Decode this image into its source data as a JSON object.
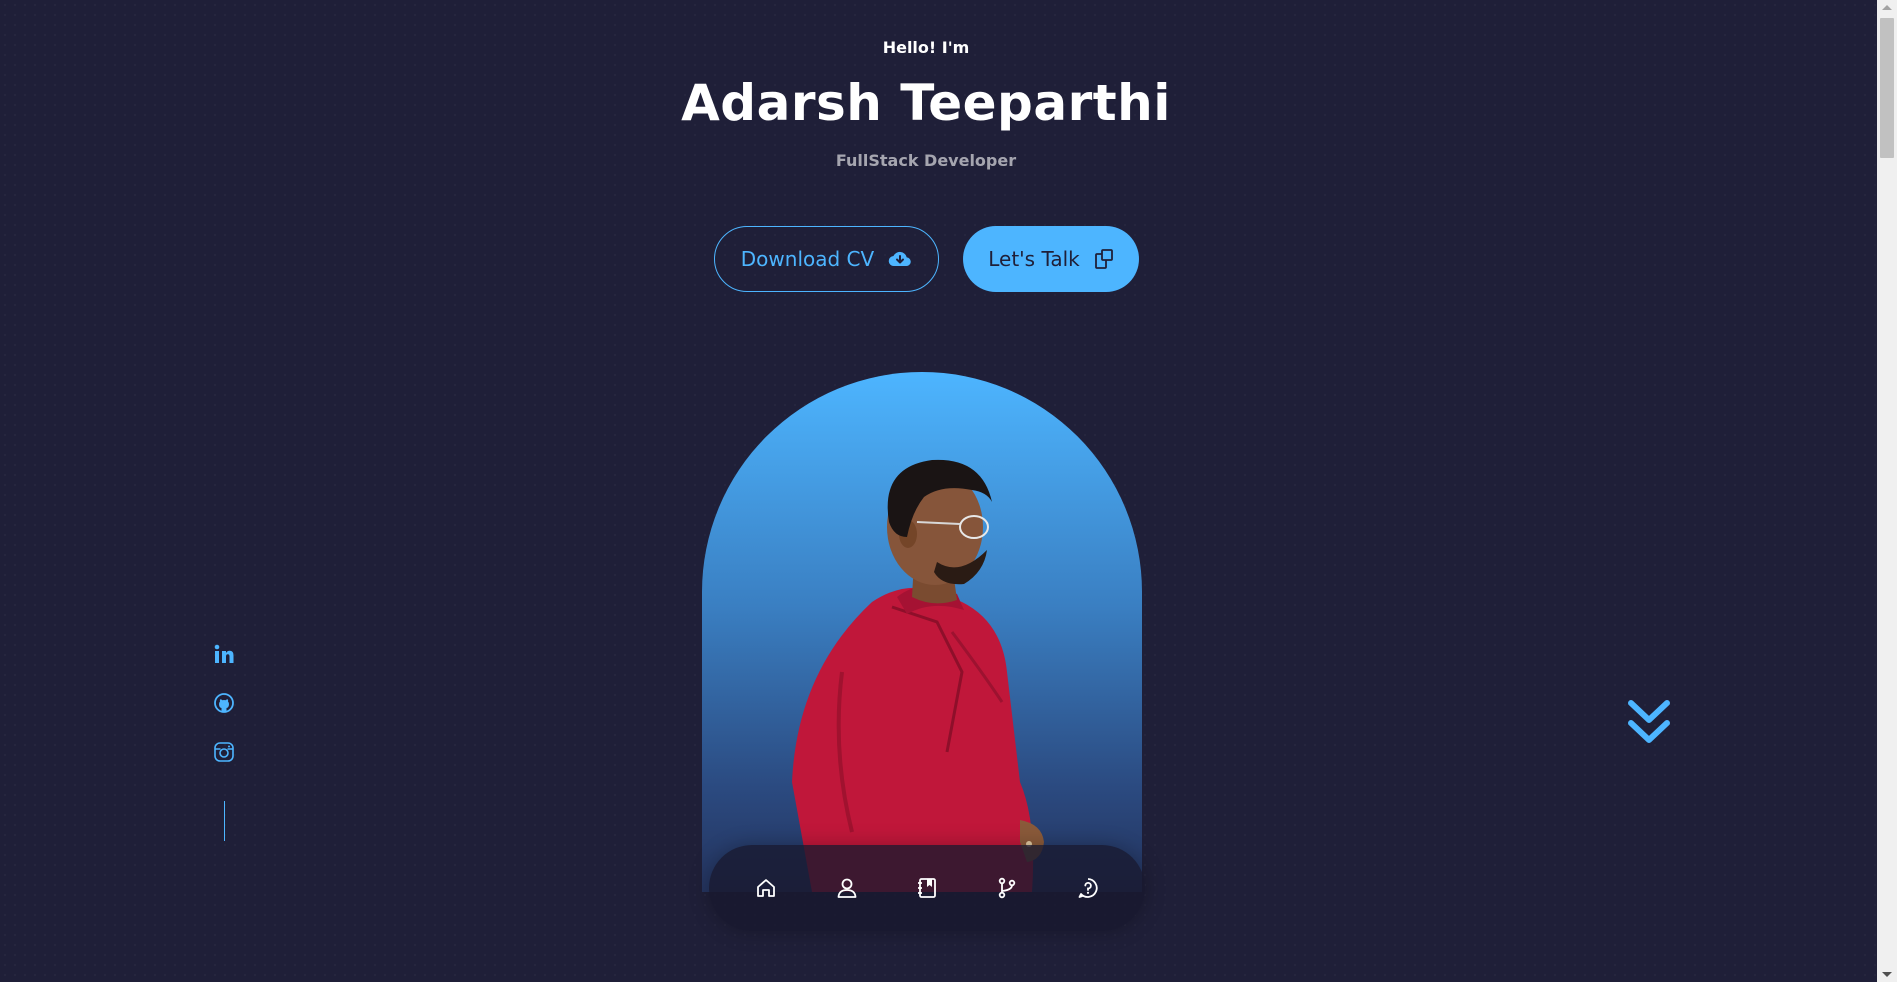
{
  "header": {
    "greeting": "Hello! I'm",
    "name": "Adarsh Teeparthi",
    "role": "FullStack Developer"
  },
  "cta": {
    "download_label": "Download CV",
    "talk_label": "Let's Talk"
  },
  "nav": {
    "items": [
      {
        "icon": "home-icon"
      },
      {
        "icon": "user-icon"
      },
      {
        "icon": "notebook-icon"
      },
      {
        "icon": "git-branch-icon"
      },
      {
        "icon": "help-icon"
      }
    ]
  },
  "socials": [
    {
      "icon": "linkedin-icon"
    },
    {
      "icon": "github-icon"
    },
    {
      "icon": "instagram-icon"
    }
  ],
  "colors": {
    "background": "#1f1f38",
    "accent": "#4db5ff",
    "text": "#ffffff"
  }
}
